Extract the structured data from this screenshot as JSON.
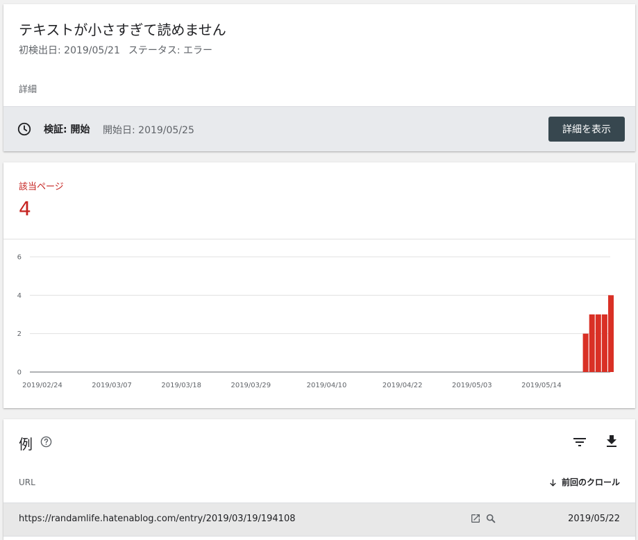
{
  "issue": {
    "title": "テキストが小さすぎて読めません",
    "first_detected": "初検出日: 2019/05/21",
    "status": "ステータス: エラー",
    "details_label": "詳細"
  },
  "validation": {
    "label": "検証: 開始",
    "started": "開始日: 2019/05/25",
    "button_label": "詳細を表示",
    "clock_icon": "clock-icon"
  },
  "affected": {
    "label": "該当ページ",
    "count": "4",
    "color": "#c5221f"
  },
  "chart_data": {
    "type": "bar",
    "color": "#d93025",
    "grid": true,
    "ylim": [
      0,
      6
    ],
    "y_ticks": [
      "0",
      "2",
      "4",
      "6"
    ],
    "x_ticks": [
      "2019/02/24",
      "2019/03/07",
      "2019/03/18",
      "2019/03/29",
      "2019/04/10",
      "2019/04/22",
      "2019/05/03",
      "2019/05/14"
    ],
    "x": [
      "2019/05/21",
      "2019/05/22",
      "2019/05/23",
      "2019/05/24",
      "2019/05/25"
    ],
    "values": [
      2,
      3,
      3,
      3,
      4
    ]
  },
  "examples": {
    "title": "例",
    "help_icon": "help-icon",
    "filter_icon": "filter-icon",
    "download_icon": "download-icon",
    "columns": {
      "url": "URL",
      "last_crawl": "前回のクロール"
    },
    "rows": [
      {
        "url": "https://randamlife.hatenablog.com/entry/2019/03/19/194108",
        "last_crawl": "2019/05/22"
      }
    ]
  }
}
